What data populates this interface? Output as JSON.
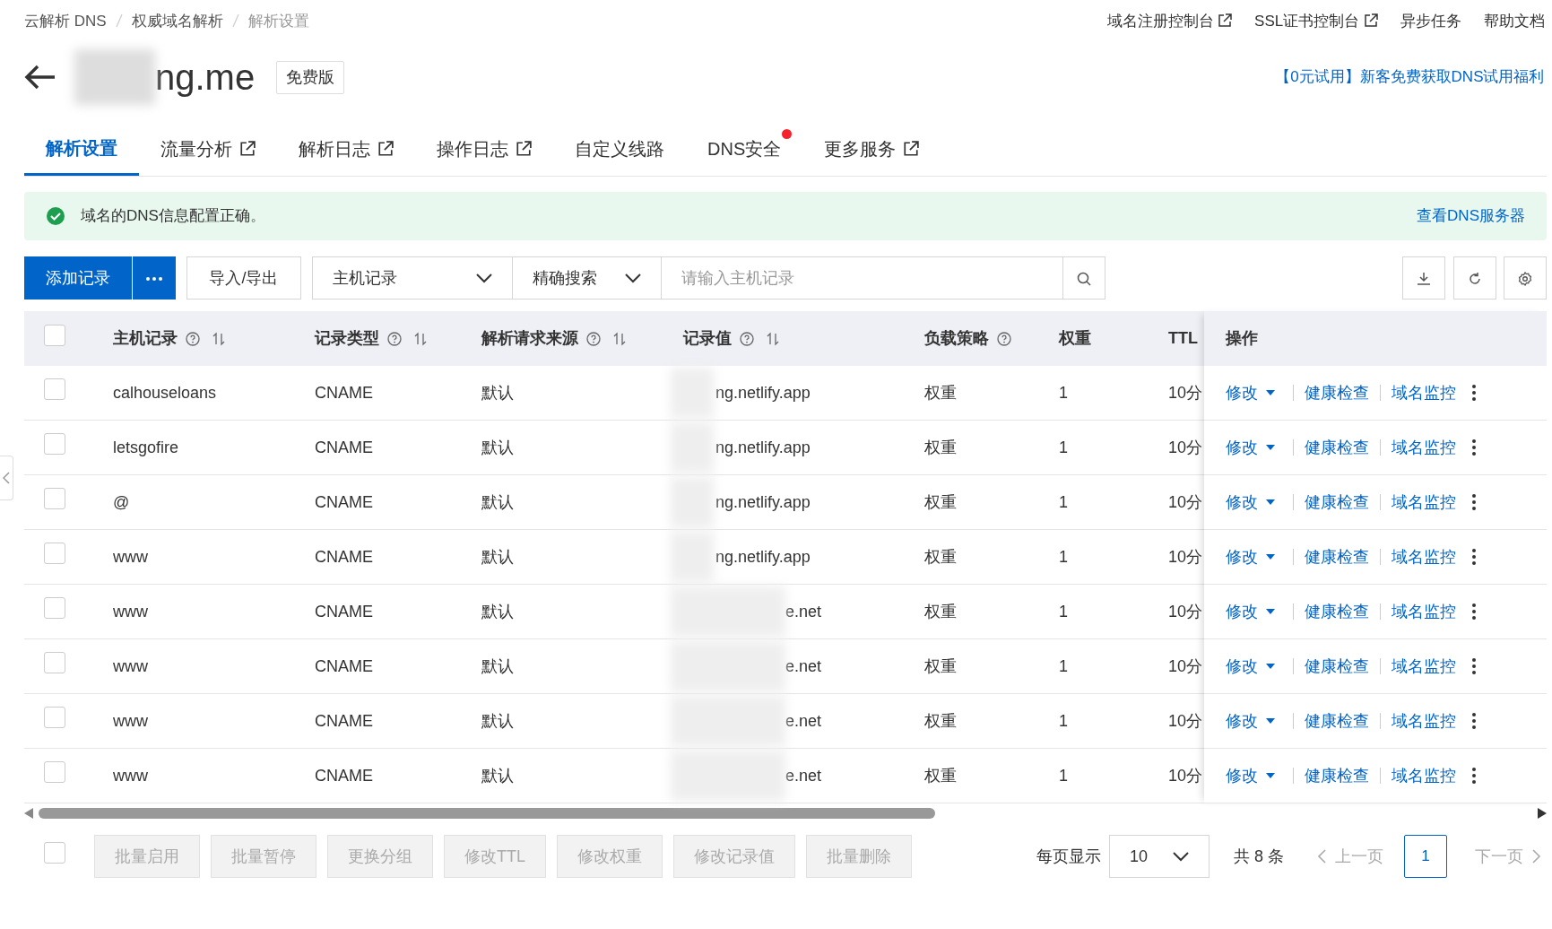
{
  "breadcrumb": [
    {
      "label": "云解析 DNS",
      "current": false
    },
    {
      "label": "权威域名解析",
      "current": false
    },
    {
      "label": "解析设置",
      "current": true
    }
  ],
  "top_links": [
    {
      "label": "域名注册控制台",
      "external": true
    },
    {
      "label": "SSL证书控制台",
      "external": true
    },
    {
      "label": "异步任务",
      "external": false
    },
    {
      "label": "帮助文档",
      "external": false
    }
  ],
  "domain": {
    "name": "ng.me",
    "edition": "免费版"
  },
  "promo_link": "【0元试用】新客免费获取DNS试用福利",
  "tabs": [
    {
      "label": "解析设置",
      "selected": true,
      "external": false,
      "dot": false
    },
    {
      "label": "流量分析",
      "selected": false,
      "external": true,
      "dot": false
    },
    {
      "label": "解析日志",
      "selected": false,
      "external": true,
      "dot": false
    },
    {
      "label": "操作日志",
      "selected": false,
      "external": true,
      "dot": false
    },
    {
      "label": "自定义线路",
      "selected": false,
      "external": false,
      "dot": false
    },
    {
      "label": "DNS安全",
      "selected": false,
      "external": false,
      "dot": true
    },
    {
      "label": "更多服务",
      "selected": false,
      "external": true,
      "dot": false
    }
  ],
  "alert": {
    "text": "域名的DNS信息配置正确。",
    "link": "查看DNS服务器"
  },
  "toolbar": {
    "add_button": "添加记录",
    "import_export": "导入/导出",
    "filter_field": "主机记录",
    "search_mode": "精确搜索",
    "search": {
      "placeholder": "请输入主机记录"
    }
  },
  "table": {
    "select_all": {
      "checked": false
    },
    "columns": [
      {
        "label": "主机记录",
        "help": true,
        "sortable": true
      },
      {
        "label": "记录类型",
        "help": true,
        "sortable": true
      },
      {
        "label": "解析请求来源",
        "help": true,
        "sortable": true
      },
      {
        "label": "记录值",
        "help": true,
        "sortable": true
      },
      {
        "label": "负载策略",
        "help": true,
        "sortable": false
      },
      {
        "label": "权重",
        "help": false,
        "sortable": false
      },
      {
        "label": "TTL",
        "help": false,
        "sortable": false
      },
      {
        "label": "操作",
        "help": false,
        "sortable": false
      }
    ],
    "rows": [
      {
        "checked": false,
        "host": "calhouseloans",
        "type": "CNAME",
        "source": "默认",
        "value": "ng.netlify.app",
        "strategy": "权重",
        "weight": "1",
        "ttl": "10分",
        "actions": [
          "修改",
          "健康检查",
          "域名监控"
        ]
      },
      {
        "checked": false,
        "host": "letsgofire",
        "type": "CNAME",
        "source": "默认",
        "value": "ng.netlify.app",
        "strategy": "权重",
        "weight": "1",
        "ttl": "10分",
        "actions": [
          "修改",
          "健康检查",
          "域名监控"
        ]
      },
      {
        "checked": false,
        "host": "@",
        "type": "CNAME",
        "source": "默认",
        "value": "ng.netlify.app",
        "strategy": "权重",
        "weight": "1",
        "ttl": "10分",
        "actions": [
          "修改",
          "健康检查",
          "域名监控"
        ]
      },
      {
        "checked": false,
        "host": "www",
        "type": "CNAME",
        "source": "默认",
        "value": "ng.netlify.app",
        "strategy": "权重",
        "weight": "1",
        "ttl": "10分",
        "actions": [
          "修改",
          "健康检查",
          "域名监控"
        ]
      },
      {
        "checked": false,
        "host": "www",
        "type": "CNAME",
        "source": "默认",
        "value": "e.net",
        "strategy": "权重",
        "weight": "1",
        "ttl": "10分",
        "actions": [
          "修改",
          "健康检查",
          "域名监控"
        ]
      },
      {
        "checked": false,
        "host": "www",
        "type": "CNAME",
        "source": "默认",
        "value": "e.net",
        "strategy": "权重",
        "weight": "1",
        "ttl": "10分",
        "actions": [
          "修改",
          "健康检查",
          "域名监控"
        ]
      },
      {
        "checked": false,
        "host": "www",
        "type": "CNAME",
        "source": "默认",
        "value": "e.net",
        "strategy": "权重",
        "weight": "1",
        "ttl": "10分",
        "actions": [
          "修改",
          "健康检查",
          "域名监控"
        ]
      },
      {
        "checked": false,
        "host": "www",
        "type": "CNAME",
        "source": "默认",
        "value": "e.net",
        "strategy": "权重",
        "weight": "1",
        "ttl": "10分",
        "actions": [
          "修改",
          "健康检查",
          "域名监控"
        ]
      }
    ]
  },
  "footer": {
    "select_all": {
      "checked": false
    },
    "batch_buttons": [
      {
        "label": "批量启用",
        "disabled": true
      },
      {
        "label": "批量暂停",
        "disabled": true
      },
      {
        "label": "更换分组",
        "disabled": true
      },
      {
        "label": "修改TTL",
        "disabled": true
      },
      {
        "label": "修改权重",
        "disabled": true
      },
      {
        "label": "修改记录值",
        "disabled": true
      },
      {
        "label": "批量删除",
        "disabled": true
      }
    ],
    "page_size_label": "每页显示",
    "page_size": "10",
    "total": "共 8 条",
    "prev": "上一页",
    "pages": [
      {
        "label": "1",
        "selected": true
      }
    ],
    "next": "下一页"
  }
}
